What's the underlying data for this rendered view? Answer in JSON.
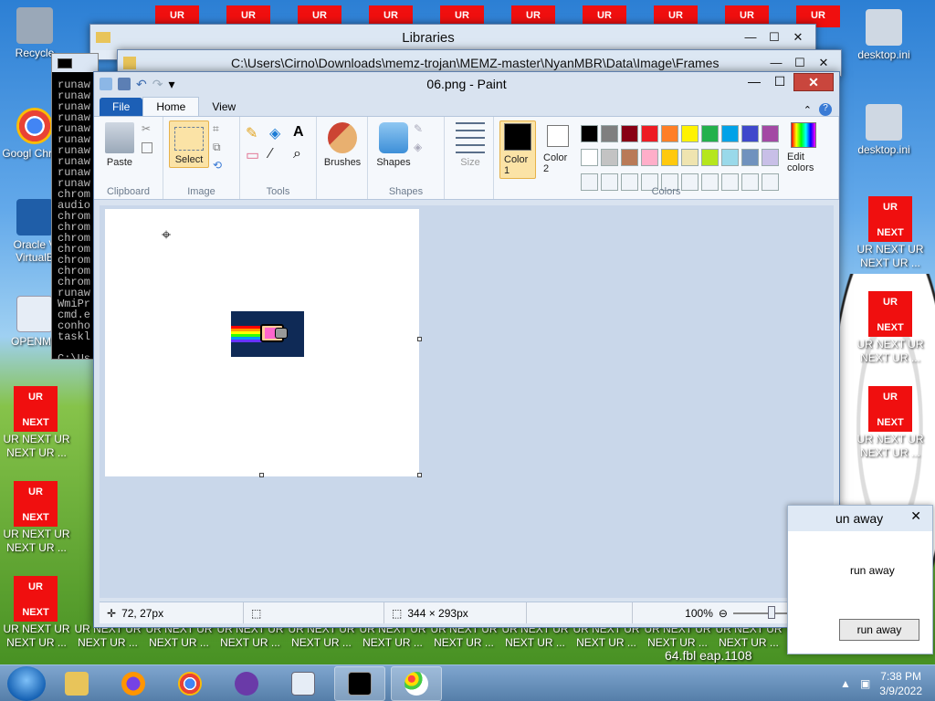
{
  "desktop": {
    "icons": [
      {
        "label": "Recycle",
        "color": "#8aa0b8"
      },
      {
        "label": "Googl Chrom",
        "color": "#e94235"
      },
      {
        "label": "Oracle V VirtualB",
        "color": "#1f5ea8"
      },
      {
        "label": "OPENME",
        "color": "#e6edf6"
      }
    ],
    "right_icons": [
      {
        "label": "desktop.ini"
      },
      {
        "label": "desktop.ini"
      }
    ],
    "ur_box": {
      "top": "UR",
      "bottom": "NEXT"
    },
    "ur_caption": "UR NEXT UR NEXT UR ...",
    "top_ur": "UR",
    "bg_text": "64.fbl eap.1108"
  },
  "libraries": {
    "title": "Libraries"
  },
  "explorer": {
    "path": "C:\\Users\\Cirno\\Downloads\\memz-trojan\\MEMZ-master\\NyanMBR\\Data\\Image\\Frames"
  },
  "cmd": {
    "lines": [
      "runaw",
      "runaw",
      "runaw",
      "runaw",
      "runaw",
      "runaw",
      "runaw",
      "runaw",
      "runaw",
      "runaw",
      "chrom",
      "audio",
      "chrom",
      "chrom",
      "chrom",
      "chrom",
      "chrom",
      "chrom",
      "chrom",
      "runaw",
      "WmiPr",
      "cmd.e",
      "conho",
      "taskl",
      "",
      "C:\\Us"
    ]
  },
  "paint": {
    "title": "06.png - Paint",
    "tabs": [
      "File",
      "Home",
      "View"
    ],
    "clipboard": {
      "paste": "Paste",
      "group": "Clipboard"
    },
    "image": {
      "select": "Select",
      "group": "Image"
    },
    "tools": {
      "group": "Tools"
    },
    "shapes": {
      "brushes": "Brushes",
      "shapes": "Shapes",
      "group": "Shapes",
      "size": "Size"
    },
    "colors": {
      "color1": "Color 1",
      "color2": "Color 2",
      "edit": "Edit colors",
      "group": "Colors",
      "palette": [
        "#000000",
        "#7f7f7f",
        "#880015",
        "#ed1c24",
        "#ff7f27",
        "#fff200",
        "#22b14c",
        "#00a2e8",
        "#3f48cc",
        "#a349a4",
        "#ffffff",
        "#c3c3c3",
        "#b97a57",
        "#ffaec9",
        "#ffc90e",
        "#efe4b0",
        "#b5e61d",
        "#99d9ea",
        "#7092be",
        "#c8bfe7"
      ]
    },
    "status": {
      "cursor": "72, 27px",
      "size": "344 × 293px",
      "zoom": "100%"
    }
  },
  "runaway": {
    "title": "un away",
    "message": "run away",
    "button": "run away",
    "close": "✕"
  },
  "taskbar": {
    "time": "7:38 PM",
    "date": "3/9/2022"
  }
}
